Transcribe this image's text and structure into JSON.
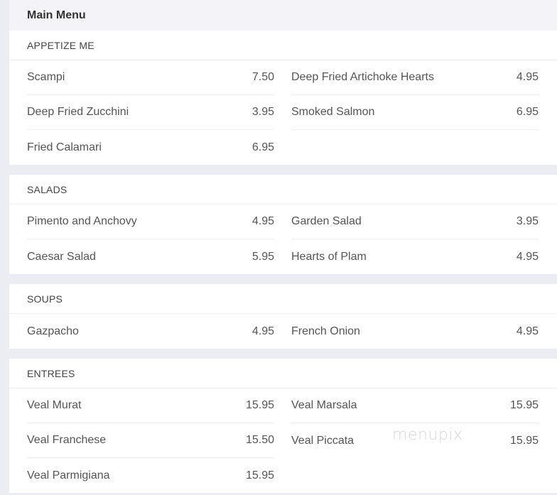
{
  "header": {
    "title": "Main Menu"
  },
  "sections": [
    {
      "title": "APPETIZE ME",
      "items": [
        {
          "name": "Scampi",
          "price": "7.50"
        },
        {
          "name": "Deep Fried Artichoke Hearts",
          "price": "4.95"
        },
        {
          "name": "Deep Fried Zucchini",
          "price": "3.95"
        },
        {
          "name": "Smoked Salmon",
          "price": "6.95"
        },
        {
          "name": "Fried Calamari",
          "price": "6.95"
        }
      ]
    },
    {
      "title": "SALADS",
      "items": [
        {
          "name": "Pimento and Anchovy",
          "price": "4.95"
        },
        {
          "name": "Garden Salad",
          "price": "3.95"
        },
        {
          "name": "Caesar Salad",
          "price": "5.95"
        },
        {
          "name": "Hearts of Plam",
          "price": "4.95"
        }
      ]
    },
    {
      "title": "SOUPS",
      "items": [
        {
          "name": "Gazpacho",
          "price": "4.95"
        },
        {
          "name": "French Onion",
          "price": "4.95"
        }
      ]
    },
    {
      "title": "ENTREES",
      "items": [
        {
          "name": "Veal Murat",
          "price": "15.95"
        },
        {
          "name": "Veal Marsala",
          "price": "15.95"
        },
        {
          "name": "Veal Franchese",
          "price": "15.50"
        },
        {
          "name": "Veal Piccata",
          "price": "15.95"
        },
        {
          "name": "Veal Parmigiana",
          "price": "15.95"
        }
      ]
    }
  ],
  "watermark": {
    "text": "menupix"
  }
}
